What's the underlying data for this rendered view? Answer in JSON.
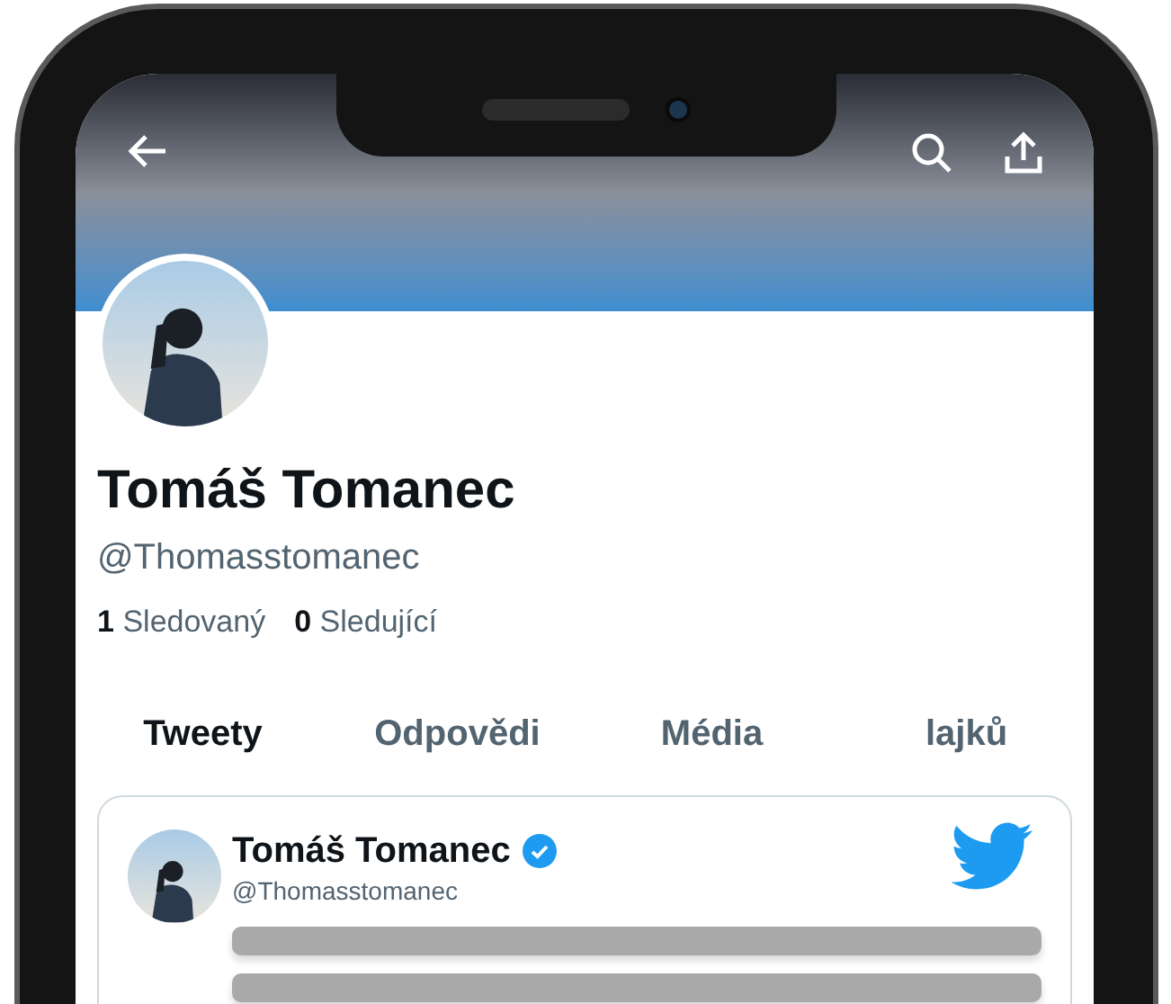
{
  "profile": {
    "name": "Tomáš Tomanec",
    "handle": "@Thomasstomanec",
    "stats": [
      {
        "count": "1",
        "label": "Sledovaný"
      },
      {
        "count": "0",
        "label": "Sledující"
      }
    ]
  },
  "tabs": [
    {
      "label": "Tweety",
      "selected": true
    },
    {
      "label": "Odpovědi",
      "selected": false
    },
    {
      "label": "Média",
      "selected": false
    },
    {
      "label": "lajků",
      "selected": false
    }
  ],
  "tweet": {
    "name": "Tomáš Tomanec",
    "handle": "@Thomasstomanec",
    "verified": true
  }
}
